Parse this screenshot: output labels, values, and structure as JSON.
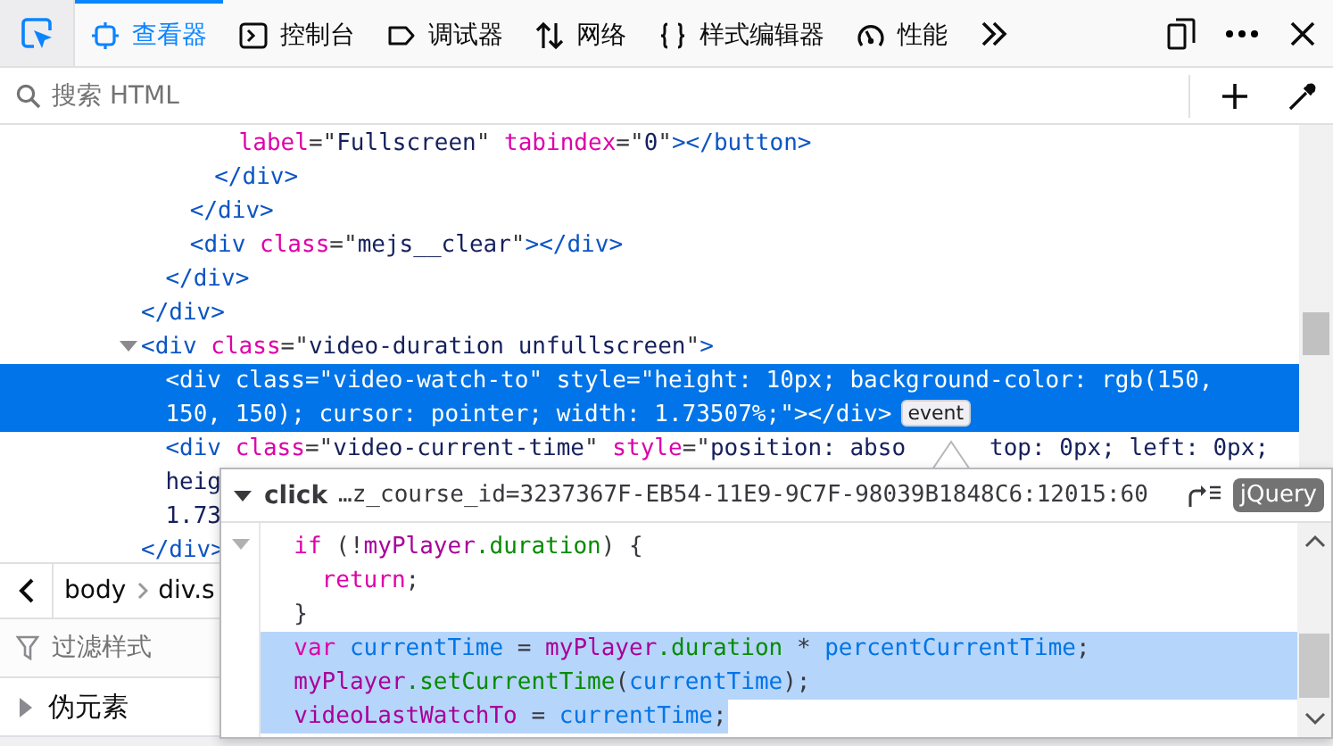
{
  "toolbar": {
    "tabs": [
      {
        "label": "查看器",
        "kind": "inspector",
        "selected": true
      },
      {
        "label": "控制台",
        "kind": "console",
        "selected": false
      },
      {
        "label": "调试器",
        "kind": "debugger",
        "selected": false
      },
      {
        "label": "网络",
        "kind": "network",
        "selected": false
      },
      {
        "label": "样式编辑器",
        "kind": "style",
        "selected": false
      },
      {
        "label": "性能",
        "kind": "performance",
        "selected": false
      }
    ]
  },
  "search": {
    "placeholder": "搜索 HTML"
  },
  "markup": {
    "nodes": [
      {
        "closing": [
          {
            "kind": "tag",
            "text": "</div>"
          }
        ],
        "children": [
          {
            "closing": [
              {
                "kind": "tag",
                "text": "</div>"
              }
            ],
            "children": [
              {
                "closing": [
                  {
                    "kind": "tag",
                    "text": "</div>"
                  }
                ],
                "children": [
                  {
                    "closing": [
                      {
                        "kind": "tag",
                        "text": "</div>"
                      }
                    ],
                    "children": [
                      {
                        "selected": false,
                        "lines": [
                          [
                            {
                              "kind": "attr",
                              "text": "label"
                            },
                            {
                              "kind": "punct",
                              "text": "=\""
                            },
                            {
                              "kind": "value",
                              "text": "Fullscreen"
                            },
                            {
                              "kind": "punct",
                              "text": "\" "
                            },
                            {
                              "kind": "attr",
                              "text": "tabindex"
                            },
                            {
                              "kind": "punct",
                              "text": "=\""
                            },
                            {
                              "kind": "value",
                              "text": "0"
                            },
                            {
                              "kind": "punct",
                              "text": "\""
                            },
                            {
                              "kind": "tag",
                              "text": "></button>"
                            }
                          ]
                        ]
                      }
                    ]
                  }
                ]
              },
              {
                "selected": false,
                "lines": [
                  [
                    {
                      "kind": "tag",
                      "text": "<div "
                    },
                    {
                      "kind": "attr",
                      "text": "class"
                    },
                    {
                      "kind": "punct",
                      "text": "=\""
                    },
                    {
                      "kind": "value",
                      "text": "mejs__clear"
                    },
                    {
                      "kind": "punct",
                      "text": "\""
                    },
                    {
                      "kind": "tag",
                      "text": "></div>"
                    }
                  ]
                ]
              }
            ]
          }
        ]
      },
      {
        "selected": false,
        "expanded": true,
        "lines": [
          [
            {
              "kind": "tag",
              "text": "<div "
            },
            {
              "kind": "attr",
              "text": "class"
            },
            {
              "kind": "punct",
              "text": "=\""
            },
            {
              "kind": "value",
              "text": "video-duration unfullscreen"
            },
            {
              "kind": "punct",
              "text": "\""
            },
            {
              "kind": "tag",
              "text": ">"
            }
          ]
        ],
        "closing": [
          {
            "kind": "tag",
            "text": "</div>"
          }
        ],
        "children": [
          {
            "selected": true,
            "badge": "event",
            "lines": [
              [
                {
                  "kind": "tag",
                  "text": "<div "
                },
                {
                  "kind": "attr",
                  "text": "class"
                },
                {
                  "kind": "punct",
                  "text": "=\""
                },
                {
                  "kind": "value",
                  "text": "video-watch-to"
                },
                {
                  "kind": "punct",
                  "text": "\" "
                },
                {
                  "kind": "attr",
                  "text": "style"
                },
                {
                  "kind": "punct",
                  "text": "=\""
                },
                {
                  "kind": "value",
                  "text": "height: 10px; background-color: rgb(150,"
                }
              ],
              [
                {
                  "kind": "value",
                  "text": "150, 150); cursor: pointer; width: 1.73507%;"
                },
                {
                  "kind": "punct",
                  "text": "\""
                },
                {
                  "kind": "tag",
                  "text": "></div>"
                }
              ]
            ]
          },
          {
            "selected": false,
            "lines": [
              [
                {
                  "kind": "tag",
                  "text": "<div "
                },
                {
                  "kind": "attr",
                  "text": "class"
                },
                {
                  "kind": "punct",
                  "text": "=\""
                },
                {
                  "kind": "value",
                  "text": "video-current-time"
                },
                {
                  "kind": "punct",
                  "text": "\" "
                },
                {
                  "kind": "attr",
                  "text": "style"
                },
                {
                  "kind": "punct",
                  "text": "=\""
                },
                {
                  "kind": "value",
                  "text": "position: abso"
                },
                {
                  "kind": "gap"
                },
                {
                  "kind": "value",
                  "text": "top: 0px; left: 0px;"
                }
              ],
              [
                {
                  "kind": "value",
                  "text": "heig"
                }
              ],
              [
                {
                  "kind": "value",
                  "text": "1.73"
                }
              ]
            ]
          }
        ]
      }
    ]
  },
  "breadcrumbs": [
    "body",
    "div.s"
  ],
  "rules": {
    "filter_placeholder": "过滤样式",
    "pseudo": {
      "label": "伪元素",
      "expanded": false
    }
  },
  "event_popup": {
    "event": "click",
    "expanded": true,
    "source": "…z_course_id=3237367F-EB54-11E9-9C7F-98039B1848C6:12015:60",
    "library": "jQuery",
    "body_expanded": true,
    "lines": [
      {
        "selected": false,
        "tokens": [
          {
            "kind": "keyword",
            "text": "  if"
          },
          {
            "kind": "punct",
            "text": " (!"
          },
          {
            "kind": "variable",
            "text": "myPlayer"
          },
          {
            "kind": "prop",
            "text": ".duration"
          },
          {
            "kind": "punct",
            "text": ") {"
          }
        ]
      },
      {
        "selected": false,
        "tokens": [
          {
            "kind": "keyword",
            "text": "    return"
          },
          {
            "kind": "punct",
            "text": ";"
          }
        ]
      },
      {
        "selected": false,
        "tokens": [
          {
            "kind": "punct",
            "text": "  }"
          }
        ]
      },
      {
        "selected": true,
        "tokens": [
          {
            "kind": "keyword",
            "text": "  var"
          },
          {
            "kind": "def",
            "text": " currentTime"
          },
          {
            "kind": "punct",
            "text": " = "
          },
          {
            "kind": "variable",
            "text": "myPlayer"
          },
          {
            "kind": "prop",
            "text": ".duration"
          },
          {
            "kind": "punct",
            "text": " * "
          },
          {
            "kind": "def",
            "text": "percentCurrentTime"
          },
          {
            "kind": "punct",
            "text": ";"
          }
        ]
      },
      {
        "selected": true,
        "tokens": [
          {
            "kind": "variable",
            "text": "  myPlayer"
          },
          {
            "kind": "prop",
            "text": ".setCurrentTime"
          },
          {
            "kind": "punct",
            "text": "("
          },
          {
            "kind": "def",
            "text": "currentTime"
          },
          {
            "kind": "punct",
            "text": ");"
          }
        ]
      },
      {
        "selected": true,
        "tokens": [
          {
            "kind": "variable",
            "text": "  videoLastWatchTo"
          },
          {
            "kind": "punct",
            "text": " = "
          },
          {
            "kind": "def",
            "text": "currentTime"
          },
          {
            "kind": "punct",
            "text": ";"
          }
        ]
      }
    ]
  }
}
